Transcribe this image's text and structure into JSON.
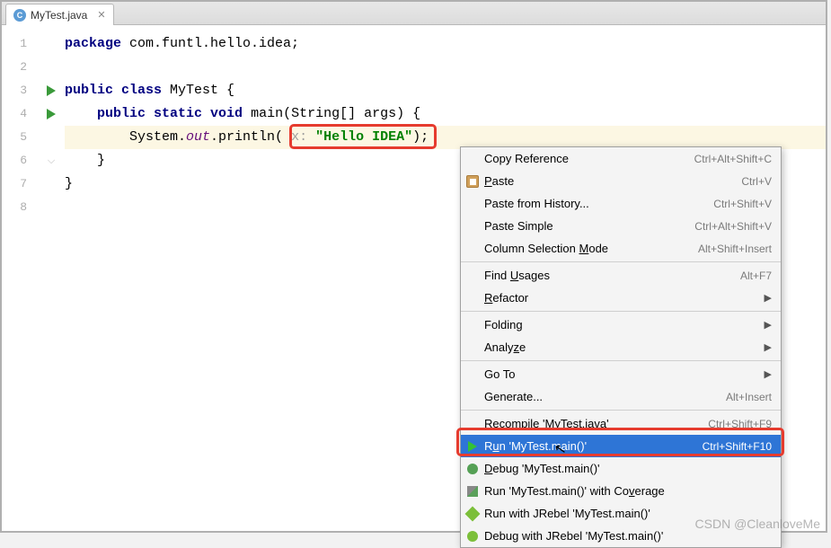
{
  "tab": {
    "filename": "MyTest.java"
  },
  "code": {
    "l1_kw": "package",
    "l1_rest": " com.funtl.hello.idea;",
    "l3a": "public",
    "l3b": " class",
    "l3c": " MyTest {",
    "l4a": "public",
    "l4b": " static",
    "l4c": " void",
    "l4d": " main(String[] args) {",
    "l5a": "System.",
    "l5b": "out",
    "l5c": ".println(",
    "l5hint": " x: ",
    "l5str": "\"Hello IDEA\"",
    "l5end": ");",
    "l6": "}",
    "l7": "}"
  },
  "lines": [
    "1",
    "2",
    "3",
    "4",
    "5",
    "6",
    "7",
    "8"
  ],
  "menu": {
    "copy_ref": "Copy Reference",
    "copy_ref_sc": "Ctrl+Alt+Shift+C",
    "paste": "Paste",
    "paste_u": "P",
    "paste_sc": "Ctrl+V",
    "paste_hist": "Paste from History...",
    "paste_hist_sc": "Ctrl+Shift+V",
    "paste_simple": "Paste Simple",
    "paste_simple_sc": "Ctrl+Alt+Shift+V",
    "col_sel": "Column Selection Mode",
    "col_sel_u": "M",
    "col_sel_sc": "Alt+Shift+Insert",
    "find_usages": "Find Usages",
    "find_usages_u": "U",
    "find_usages_sc": "Alt+F7",
    "refactor": "Refactor",
    "refactor_u": "R",
    "folding": "Folding",
    "analyze": "Analyze",
    "analyze_u": "z",
    "goto": "Go To",
    "generate": "Generate...",
    "generate_sc": "Alt+Insert",
    "recompile": "Recompile 'MyTest.java'",
    "recompile_sc": "Ctrl+Shift+F9",
    "run": "Run 'MyTest.main()'",
    "run_u": "u",
    "run_sc": "Ctrl+Shift+F10",
    "debug": "Debug 'MyTest.main()'",
    "debug_u": "D",
    "coverage": "Run 'MyTest.main()' with Coverage",
    "coverage_u": "v",
    "jrebel": "Run with JRebel 'MyTest.main()'",
    "jrebel_dbg": "Debug with JRebel 'MyTest.main()'"
  },
  "watermark": "CSDN @CleanloveMe"
}
